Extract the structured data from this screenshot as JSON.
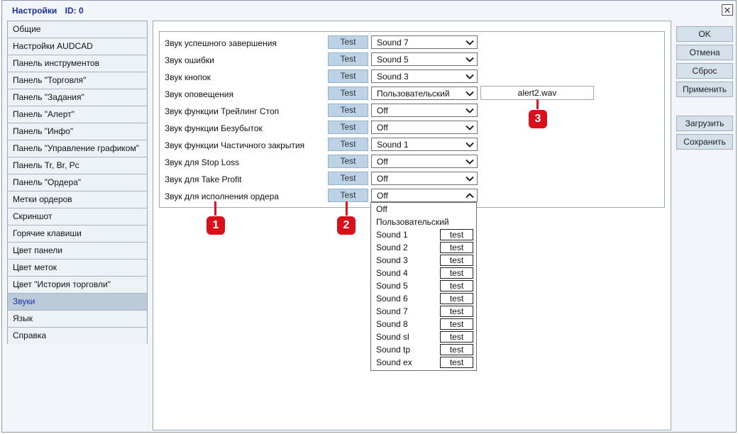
{
  "window": {
    "title": "Настройки",
    "id_label": "ID: 0",
    "close_glyph": "✕"
  },
  "sidebar": {
    "items": [
      "Общие",
      "Настройки AUDCAD",
      "Панель инструментов",
      "Панель \"Торговля\"",
      "Панель \"Задания\"",
      "Панель \"Алерт\"",
      "Панель \"Инфо\"",
      "Панель \"Управление графиком\"",
      "Панель Tr, Br, Pc",
      "Панель \"Ордера\"",
      "Метки ордеров",
      "Скриншот",
      "Горячие клавиши",
      "Цвет панели",
      "Цвет меток",
      "Цвет \"История торговли\"",
      "Звуки",
      "Язык",
      "Справка"
    ],
    "active_index": 16
  },
  "sounds": {
    "test_label": "Test",
    "rows": [
      {
        "label": "Звук успешного завершения",
        "value": "Sound 7"
      },
      {
        "label": "Звук ошибки",
        "value": "Sound 5"
      },
      {
        "label": "Звук кнопок",
        "value": "Sound 3"
      },
      {
        "label": "Звук оповещения",
        "value": "Пользовательский",
        "file": "alert2.wav"
      },
      {
        "label": "Звук функции Трейлинг Стоп",
        "value": "Off"
      },
      {
        "label": "Звук функции Безубыток",
        "value": "Off"
      },
      {
        "label": "Звук функции Частичного закрытия",
        "value": "Sound 1"
      },
      {
        "label": "Звук для Stop Loss",
        "value": "Off"
      },
      {
        "label": "Звук для Take Profit",
        "value": "Off"
      },
      {
        "label": "Звук для исполнения ордера",
        "value": "Off",
        "open": true
      }
    ]
  },
  "dropdown": {
    "test_label": "test",
    "options": [
      {
        "label": "Off",
        "has_test": false
      },
      {
        "label": "Пользовательский",
        "has_test": false
      },
      {
        "label": "Sound 1",
        "has_test": true
      },
      {
        "label": "Sound 2",
        "has_test": true
      },
      {
        "label": "Sound 3",
        "has_test": true
      },
      {
        "label": "Sound 4",
        "has_test": true
      },
      {
        "label": "Sound 5",
        "has_test": true
      },
      {
        "label": "Sound 6",
        "has_test": true
      },
      {
        "label": "Sound 7",
        "has_test": true
      },
      {
        "label": "Sound 8",
        "has_test": true
      },
      {
        "label": "Sound sl",
        "has_test": true
      },
      {
        "label": "Sound tp",
        "has_test": true
      },
      {
        "label": "Sound ex",
        "has_test": true
      }
    ]
  },
  "actions": {
    "ok": "OK",
    "cancel": "Отмена",
    "reset": "Сброс",
    "apply": "Применить",
    "load": "Загрузить",
    "save": "Сохранить"
  },
  "annotations": {
    "m1": "1",
    "m2": "2",
    "m3": "3"
  },
  "colors": {
    "accent_title": "#1c2e9c",
    "marker_red": "#d8101c",
    "test_button": "#bcd2e6"
  }
}
